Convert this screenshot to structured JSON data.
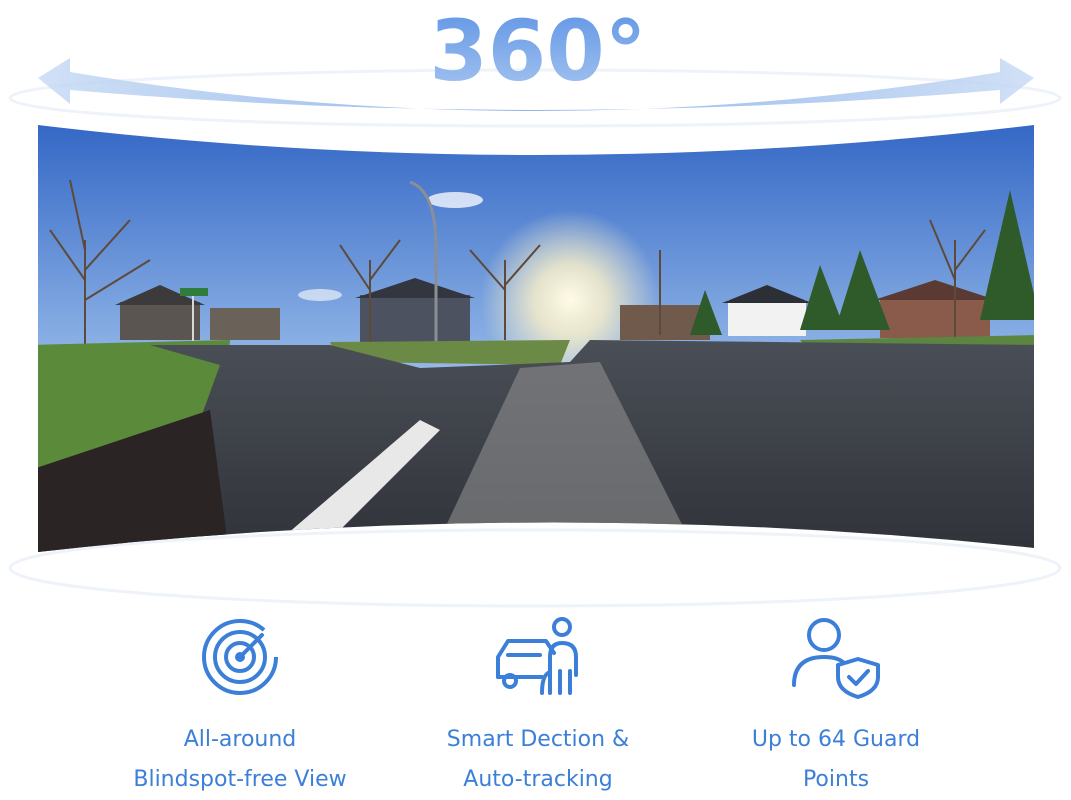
{
  "hero": {
    "degree_label": "360°",
    "image_alt": "Curved 360 degree panoramic street view"
  },
  "colors": {
    "accent": "#3c7fd8",
    "accent_light": "#c9dcf6",
    "sky_top": "#2e66c8",
    "road": "#3a3d44"
  },
  "features": [
    {
      "icon": "radar-icon",
      "line1": "All-around",
      "line2": "Blindspot-free View"
    },
    {
      "icon": "car-person-tracking-icon",
      "line1": "Smart Dection &",
      "line2": "Auto-tracking"
    },
    {
      "icon": "user-shield-icon",
      "line1": "Up to 64 Guard",
      "line2": "Points"
    }
  ]
}
